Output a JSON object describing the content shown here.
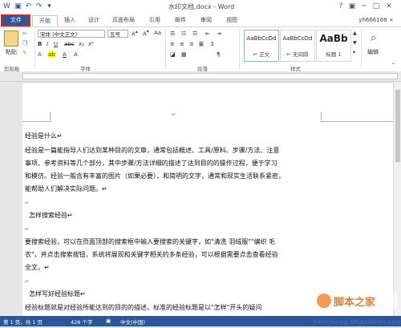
{
  "title_bar": {
    "title": "水印文档.docx - Word",
    "window_buttons": [
      "?",
      "▣",
      "─",
      "□",
      "✕"
    ]
  },
  "tabs": [
    "文件",
    "开始",
    "插入",
    "设计",
    "页面布局",
    "引用",
    "邮件",
    "审阅",
    "视图"
  ],
  "user": "yh666168 ×",
  "ribbon": {
    "clipboard": {
      "paste_label": "粘贴",
      "group_label": "剪贴板"
    },
    "font": {
      "font_name": "宋体 (中文正文)",
      "font_size": "五号",
      "group_label": "字体"
    },
    "paragraph": {
      "group_label": "段落"
    },
    "styles": {
      "items": [
        {
          "preview": "AaBbCcDd",
          "name": "↵ 正文"
        },
        {
          "preview": "AaBbCcDd",
          "name": "↵ 无间隔"
        },
        {
          "preview": "AaBb",
          "name": "标题 1"
        }
      ],
      "group_label": "样式"
    },
    "editing": {
      "label": "编辑"
    }
  },
  "document": {
    "paragraphs": [
      "经验是什么↵",
      "经验是一篇能指导人们达到某种目的的文章，通常包括概述、工具/原料、步骤/方法、注意",
      "事项、参考资料等几个部分，其中步骤/方法详细的描述了达到目的的操作过程，便于学习",
      "和模仿。经验一般含有丰富的图片（如果必要），和简明的文字，通常和现实生活联系紧密，",
      "能帮助人们解决实际问题。↵",
      "↵",
      "怎样搜索经验↵",
      "↵",
      "要搜索经验，可以在页面顶部的搜索框中输入要搜索的关键字，如\"清洗 羽绒服\"\"编织 毛",
      "衣\"，并点击搜索按钮，系统将展现和关键字相关的多条经验，可以根据需要点击查看经验",
      "全文。↵",
      "↵",
      "怎样写好经验标题↵",
      "经验标题就是对经验所能达到的目的的描述。标准的经验标题是以\"怎样\"开头的疑问"
    ]
  },
  "status_bar": {
    "page": "第 1 页，共 1 页",
    "words": "428 个字",
    "language": "中文(中国)"
  },
  "watermark": {
    "text1": "脚本之家",
    "text2": "jiaocheng.dhazidian.com"
  }
}
